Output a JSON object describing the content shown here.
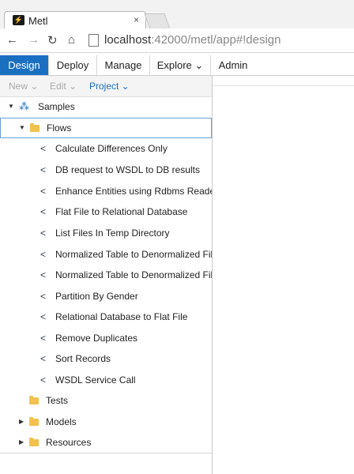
{
  "browser": {
    "tab_title": "Metl",
    "tab_close": "×",
    "url_host": "localhost",
    "url_port_path": ":42000/metl/app#!design"
  },
  "menubar": {
    "items": [
      {
        "label": "Design"
      },
      {
        "label": "Deploy"
      },
      {
        "label": "Manage"
      },
      {
        "label": "Explore ⌄"
      },
      {
        "label": "Admin"
      }
    ]
  },
  "subtoolbar": {
    "new_label": "New ⌄",
    "edit_label": "Edit ⌄",
    "project_label": "Project ⌄"
  },
  "tree": {
    "root": {
      "label": "Samples"
    },
    "flows": {
      "label": "Flows"
    },
    "flow_items": [
      "Calculate Differences Only",
      "DB request to WSDL to DB results",
      "Enhance Entities using Rdbms Reader",
      "Flat File to Relational Database",
      "List Files In Temp Directory",
      "Normalized Table to Denormalized File",
      "Normalized Table to Denormalized File",
      "Partition By Gender",
      "Relational Database to Flat File",
      "Remove Duplicates",
      "Sort Records",
      "WSDL Service Call"
    ],
    "tests": {
      "label": "Tests"
    },
    "models": {
      "label": "Models"
    },
    "resources": {
      "label": "Resources"
    }
  }
}
